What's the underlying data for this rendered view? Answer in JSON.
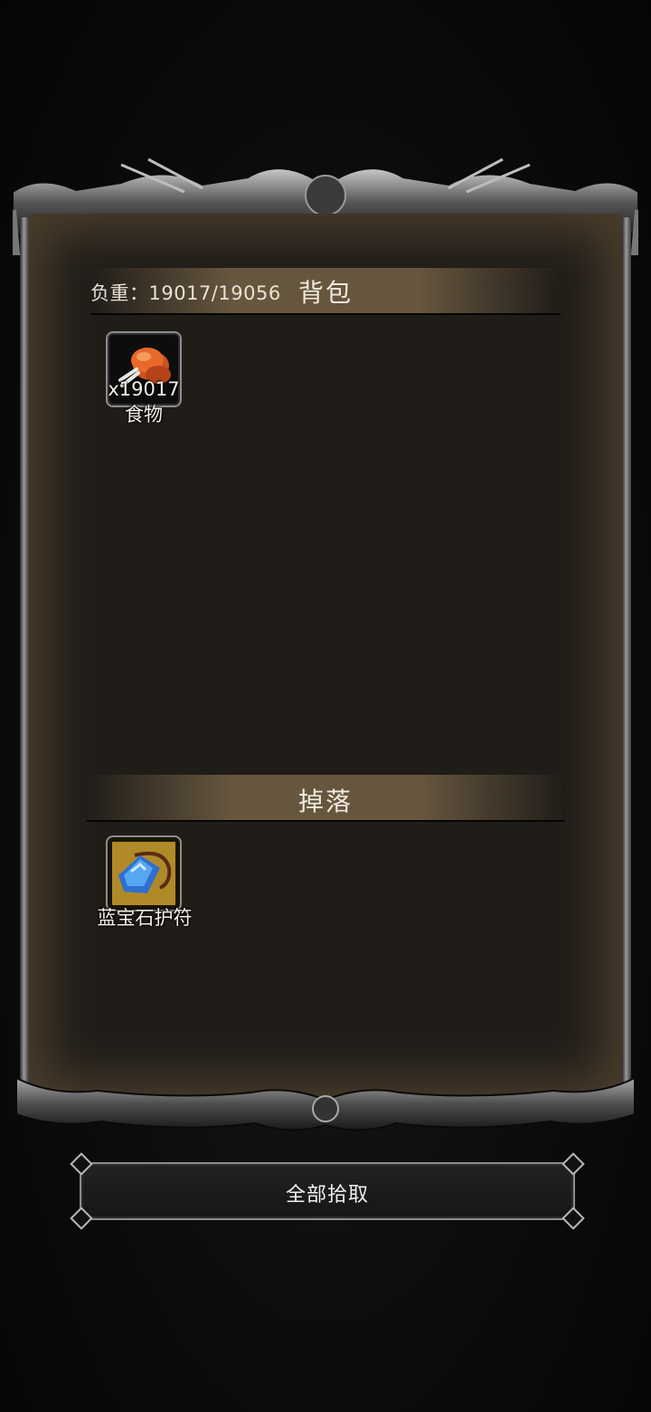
{
  "bag": {
    "title": "背包",
    "weight_label": "负重：19017/19056",
    "items": [
      {
        "name": "食物",
        "count": "x19017",
        "icon": "roasted-meat-icon"
      }
    ]
  },
  "drops": {
    "title": "掉落",
    "items": [
      {
        "name": "蓝宝石护符",
        "icon": "sapphire-amulet-icon"
      }
    ]
  },
  "actions": {
    "pickup_all": "全部拾取"
  },
  "colors": {
    "panel": "#201d19",
    "header_band": "#6e5c42",
    "amulet_slot": "#b08a28"
  }
}
